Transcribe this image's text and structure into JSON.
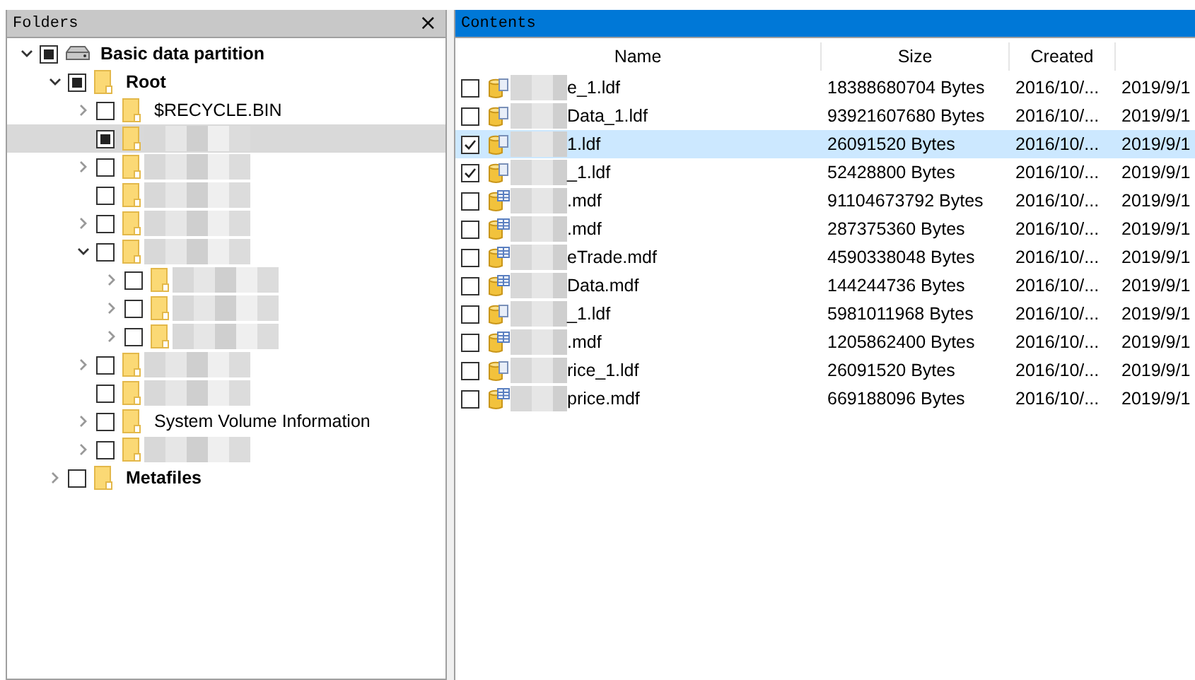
{
  "folders_panel": {
    "title": "Folders",
    "close": "×",
    "tree": [
      {
        "label": "Basic data partition",
        "kind": "drive",
        "bold": true,
        "partial": true,
        "selected": false,
        "expandable": true,
        "expanded": true,
        "children": [
          {
            "label": "Root",
            "kind": "folder",
            "bold": true,
            "partial": true,
            "selected": false,
            "expandable": true,
            "expanded": true,
            "children": [
              {
                "label": "$RECYCLE.BIN",
                "kind": "folder",
                "partial": false,
                "selected": false,
                "expandable": true,
                "expanded": false
              },
              {
                "kind": "folder",
                "partial": true,
                "redacted": true,
                "selected": true,
                "expandable": false
              },
              {
                "kind": "folder",
                "partial": false,
                "redacted": true,
                "selected": false,
                "expandable": true,
                "expanded": false
              },
              {
                "kind": "folder",
                "partial": false,
                "redacted": true,
                "selected": false,
                "expandable": false
              },
              {
                "kind": "folder",
                "partial": false,
                "redacted": true,
                "selected": false,
                "expandable": true,
                "expanded": false
              },
              {
                "kind": "folder",
                "partial": false,
                "redacted": true,
                "selected": false,
                "expandable": true,
                "expanded": true,
                "children": [
                  {
                    "kind": "folder",
                    "partial": false,
                    "redacted": true,
                    "selected": false,
                    "expandable": true,
                    "expanded": false
                  },
                  {
                    "kind": "folder",
                    "partial": false,
                    "redacted": true,
                    "selected": false,
                    "expandable": true,
                    "expanded": false
                  },
                  {
                    "kind": "folder",
                    "partial": false,
                    "redacted": true,
                    "selected": false,
                    "expandable": true,
                    "expanded": false
                  }
                ]
              },
              {
                "kind": "folder",
                "partial": false,
                "redacted": true,
                "selected": false,
                "expandable": true,
                "expanded": false
              },
              {
                "kind": "folder",
                "partial": false,
                "redacted": true,
                "selected": false,
                "expandable": false
              },
              {
                "label": "System Volume Information",
                "kind": "folder",
                "partial": false,
                "selected": false,
                "expandable": true,
                "expanded": false
              },
              {
                "kind": "folder",
                "partial": false,
                "redacted": true,
                "selected": false,
                "expandable": true,
                "expanded": false
              }
            ]
          },
          {
            "label": "Metafiles",
            "kind": "folder",
            "bold": true,
            "partial": false,
            "selected": false,
            "expandable": true,
            "expanded": false
          }
        ]
      }
    ]
  },
  "contents_panel": {
    "title": "Contents",
    "columns": [
      "Name",
      "Size",
      "Created"
    ],
    "rows": [
      {
        "checked": false,
        "selected": false,
        "kind": "ldf",
        "name": "e_1.ldf",
        "size": "18388680704 Bytes",
        "created": "2016/10/...",
        "column_4": "2019/9/1"
      },
      {
        "checked": false,
        "selected": false,
        "kind": "ldf",
        "name": "Data_1.ldf",
        "size": "93921607680 Bytes",
        "created": "2016/10/...",
        "column_4": "2019/9/1"
      },
      {
        "checked": true,
        "selected": true,
        "kind": "ldf",
        "name": "1.ldf",
        "size": "26091520 Bytes",
        "created": "2016/10/...",
        "column_4": "2019/9/1"
      },
      {
        "checked": true,
        "selected": false,
        "kind": "ldf",
        "name": "_1.ldf",
        "size": "52428800 Bytes",
        "created": "2016/10/...",
        "column_4": "2019/9/1"
      },
      {
        "checked": false,
        "selected": false,
        "kind": "mdf",
        "name": ".mdf",
        "size": "91104673792 Bytes",
        "created": "2016/10/...",
        "column_4": "2019/9/1"
      },
      {
        "checked": false,
        "selected": false,
        "kind": "mdf",
        "name": ".mdf",
        "size": "287375360 Bytes",
        "created": "2016/10/...",
        "column_4": "2019/9/1"
      },
      {
        "checked": false,
        "selected": false,
        "kind": "mdf",
        "name": "eTrade.mdf",
        "size": "4590338048 Bytes",
        "created": "2016/10/...",
        "column_4": "2019/9/1"
      },
      {
        "checked": false,
        "selected": false,
        "kind": "mdf",
        "name": "Data.mdf",
        "size": "144244736 Bytes",
        "created": "2016/10/...",
        "column_4": "2019/9/1"
      },
      {
        "checked": false,
        "selected": false,
        "kind": "ldf",
        "name": "_1.ldf",
        "size": "5981011968 Bytes",
        "created": "2016/10/...",
        "column_4": "2019/9/1"
      },
      {
        "checked": false,
        "selected": false,
        "kind": "mdf",
        "name": ".mdf",
        "size": "1205862400 Bytes",
        "created": "2016/10/...",
        "column_4": "2019/9/1"
      },
      {
        "checked": false,
        "selected": false,
        "kind": "ldf",
        "name": "rice_1.ldf",
        "size": "26091520 Bytes",
        "created": "2016/10/...",
        "column_4": "2019/9/1"
      },
      {
        "checked": false,
        "selected": false,
        "kind": "mdf",
        "name": "price.mdf",
        "size": "669188096 Bytes",
        "created": "2016/10/...",
        "column_4": "2019/9/1"
      }
    ]
  }
}
